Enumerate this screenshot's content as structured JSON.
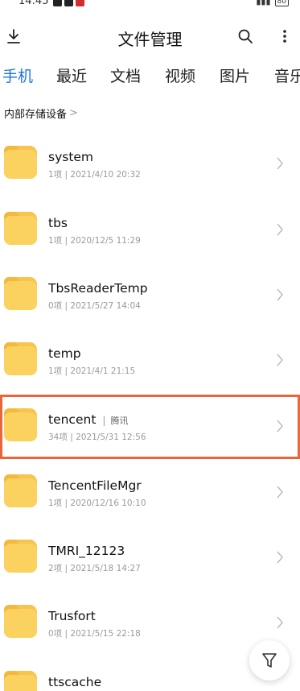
{
  "status_bar": {
    "time": "14:45",
    "battery": "80"
  },
  "header": {
    "title": "文件管理",
    "download_icon": "download-icon",
    "search_icon": "search-icon",
    "more_icon": "more-vertical-icon"
  },
  "tabs": [
    {
      "label": "手机",
      "active": true
    },
    {
      "label": "最近",
      "active": false
    },
    {
      "label": "文档",
      "active": false
    },
    {
      "label": "视频",
      "active": false
    },
    {
      "label": "图片",
      "active": false
    },
    {
      "label": "音乐",
      "active": false
    }
  ],
  "breadcrumb": {
    "label": "内部存储设备"
  },
  "files": [
    {
      "name": "system",
      "meta": "1项  |  2021/4/10 20:32",
      "tag": ""
    },
    {
      "name": "tbs",
      "meta": "1项  |  2020/12/5 11:29",
      "tag": ""
    },
    {
      "name": "TbsReaderTemp",
      "meta": "0项  |  2021/5/27 14:04",
      "tag": ""
    },
    {
      "name": "temp",
      "meta": "1项  |  2021/4/1 21:15",
      "tag": ""
    },
    {
      "name": "tencent",
      "meta": "34项  |  2021/5/31 12:56",
      "tag": "腾讯"
    },
    {
      "name": "TencentFileMgr",
      "meta": "1项  |  2020/12/16 10:10",
      "tag": ""
    },
    {
      "name": "TMRI_12123",
      "meta": "2项  |  2021/5/18 14:27",
      "tag": ""
    },
    {
      "name": "Trusfort",
      "meta": "0项  |  2021/5/15 22:18",
      "tag": ""
    },
    {
      "name": "ttscache",
      "meta": "",
      "tag": ""
    }
  ],
  "fab": {
    "icon": "filter-icon"
  },
  "colors": {
    "accent": "#1a73e8",
    "folder": "#fbd15f",
    "highlight": "#e8663a"
  }
}
